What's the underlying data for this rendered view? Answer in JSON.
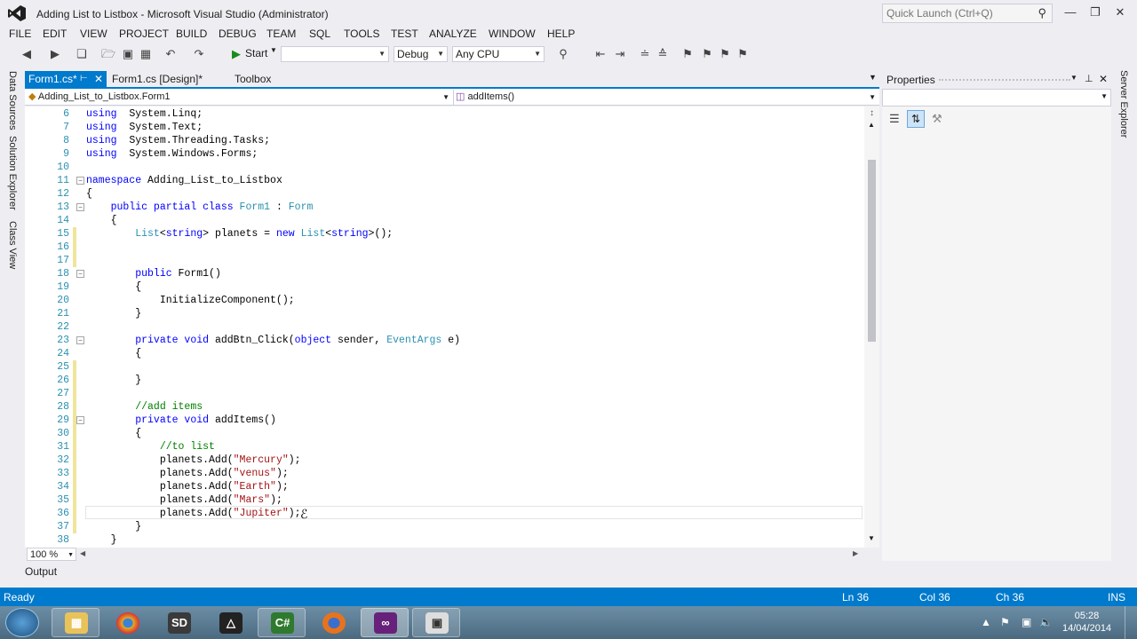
{
  "window": {
    "title": "Adding List to Listbox - Microsoft Visual Studio (Administrator)",
    "quick_launch_placeholder": "Quick Launch (Ctrl+Q)"
  },
  "menu": [
    "FILE",
    "EDIT",
    "VIEW",
    "PROJECT",
    "BUILD",
    "DEBUG",
    "TEAM",
    "SQL",
    "TOOLS",
    "TEST",
    "ANALYZE",
    "WINDOW",
    "HELP"
  ],
  "toolbar": {
    "start_label": "Start",
    "config": "Debug",
    "platform": "Any CPU"
  },
  "left_strip": [
    "Data Sources",
    "Solution Explorer",
    "Class View"
  ],
  "tabs": [
    {
      "label": "Form1.cs*",
      "active": true
    },
    {
      "label": "Form1.cs [Design]*",
      "active": false
    },
    {
      "label": "Toolbox",
      "active": false
    }
  ],
  "navbar": {
    "type_combo": "Adding_List_to_Listbox.Form1",
    "member_combo": "addItems()"
  },
  "code": [
    {
      "n": "6",
      "parts": [
        [
          "kw",
          "using"
        ],
        [
          "",
          "  System.Linq;"
        ]
      ]
    },
    {
      "n": "7",
      "parts": [
        [
          "kw",
          "using"
        ],
        [
          "",
          "  System.Text;"
        ]
      ]
    },
    {
      "n": "8",
      "parts": [
        [
          "kw",
          "using"
        ],
        [
          "",
          "  System.Threading.Tasks;"
        ]
      ]
    },
    {
      "n": "9",
      "parts": [
        [
          "kw",
          "using"
        ],
        [
          "",
          "  System.Windows.Forms;"
        ]
      ]
    },
    {
      "n": "10",
      "parts": []
    },
    {
      "n": "11",
      "parts": [
        [
          "kw",
          "namespace"
        ],
        [
          "",
          " Adding_List_to_Listbox"
        ]
      ]
    },
    {
      "n": "12",
      "parts": [
        [
          "",
          "{"
        ]
      ]
    },
    {
      "n": "13",
      "parts": [
        [
          "",
          "    "
        ],
        [
          "kw",
          "public partial class"
        ],
        [
          "",
          " "
        ],
        [
          "ty",
          "Form1"
        ],
        [
          "",
          " : "
        ],
        [
          "ty",
          "Form"
        ]
      ]
    },
    {
      "n": "14",
      "parts": [
        [
          "",
          "    {"
        ]
      ]
    },
    {
      "n": "15",
      "parts": [
        [
          "",
          "        "
        ],
        [
          "ty",
          "List"
        ],
        [
          "",
          "<"
        ],
        [
          "kw",
          "string"
        ],
        [
          "",
          "> planets = "
        ],
        [
          "kw",
          "new"
        ],
        [
          "",
          " "
        ],
        [
          "ty",
          "List"
        ],
        [
          "",
          "<"
        ],
        [
          "kw",
          "string"
        ],
        [
          "",
          ">();"
        ]
      ]
    },
    {
      "n": "16",
      "parts": []
    },
    {
      "n": "17",
      "parts": []
    },
    {
      "n": "18",
      "parts": [
        [
          "",
          "        "
        ],
        [
          "kw",
          "public"
        ],
        [
          "",
          " Form1()"
        ]
      ]
    },
    {
      "n": "19",
      "parts": [
        [
          "",
          "        {"
        ]
      ]
    },
    {
      "n": "20",
      "parts": [
        [
          "",
          "            InitializeComponent();"
        ]
      ]
    },
    {
      "n": "21",
      "parts": [
        [
          "",
          "        }"
        ]
      ]
    },
    {
      "n": "22",
      "parts": []
    },
    {
      "n": "23",
      "parts": [
        [
          "",
          "        "
        ],
        [
          "kw",
          "private void"
        ],
        [
          "",
          " addBtn_Click("
        ],
        [
          "kw",
          "object"
        ],
        [
          "",
          " sender, "
        ],
        [
          "ty",
          "EventArgs"
        ],
        [
          "",
          " e)"
        ]
      ]
    },
    {
      "n": "24",
      "parts": [
        [
          "",
          "        {"
        ]
      ]
    },
    {
      "n": "25",
      "parts": []
    },
    {
      "n": "26",
      "parts": [
        [
          "",
          "        }"
        ]
      ]
    },
    {
      "n": "27",
      "parts": []
    },
    {
      "n": "28",
      "parts": [
        [
          "",
          "        "
        ],
        [
          "cm",
          "//add items"
        ]
      ]
    },
    {
      "n": "29",
      "parts": [
        [
          "",
          "        "
        ],
        [
          "kw",
          "private void"
        ],
        [
          "",
          " addItems()"
        ]
      ]
    },
    {
      "n": "30",
      "parts": [
        [
          "",
          "        {"
        ]
      ]
    },
    {
      "n": "31",
      "parts": [
        [
          "",
          "            "
        ],
        [
          "cm",
          "//to list"
        ]
      ]
    },
    {
      "n": "32",
      "parts": [
        [
          "",
          "            planets.Add("
        ],
        [
          "st",
          "\"Mercury\""
        ],
        [
          "",
          ");"
        ]
      ]
    },
    {
      "n": "33",
      "parts": [
        [
          "",
          "            planets.Add("
        ],
        [
          "st",
          "\"venus\""
        ],
        [
          "",
          ");"
        ]
      ]
    },
    {
      "n": "34",
      "parts": [
        [
          "",
          "            planets.Add("
        ],
        [
          "st",
          "\"Earth\""
        ],
        [
          "",
          ");"
        ]
      ]
    },
    {
      "n": "35",
      "parts": [
        [
          "",
          "            planets.Add("
        ],
        [
          "st",
          "\"Mars\""
        ],
        [
          "",
          ");"
        ]
      ]
    },
    {
      "n": "36",
      "parts": [
        [
          "",
          "            planets.Add("
        ],
        [
          "st",
          "\"Jupiter\""
        ],
        [
          "",
          ");"
        ]
      ]
    },
    {
      "n": "37",
      "parts": [
        [
          "",
          "        }"
        ]
      ]
    },
    {
      "n": "38",
      "parts": [
        [
          "",
          "    }"
        ]
      ]
    }
  ],
  "zoom": "100 %",
  "properties": {
    "title": "Properties"
  },
  "right_strip": "Server Explorer",
  "output_tab": "Output",
  "status": {
    "ready": "Ready",
    "ln": "Ln 36",
    "col": "Col 36",
    "ch": "Ch 36",
    "ins": "INS"
  },
  "taskbar": {
    "time": "05:28",
    "date": "14/04/2014"
  },
  "colors": {
    "accent": "#007acc",
    "keyword": "#0000ff",
    "type": "#2b91af",
    "string": "#a31515",
    "comment": "#008000"
  }
}
